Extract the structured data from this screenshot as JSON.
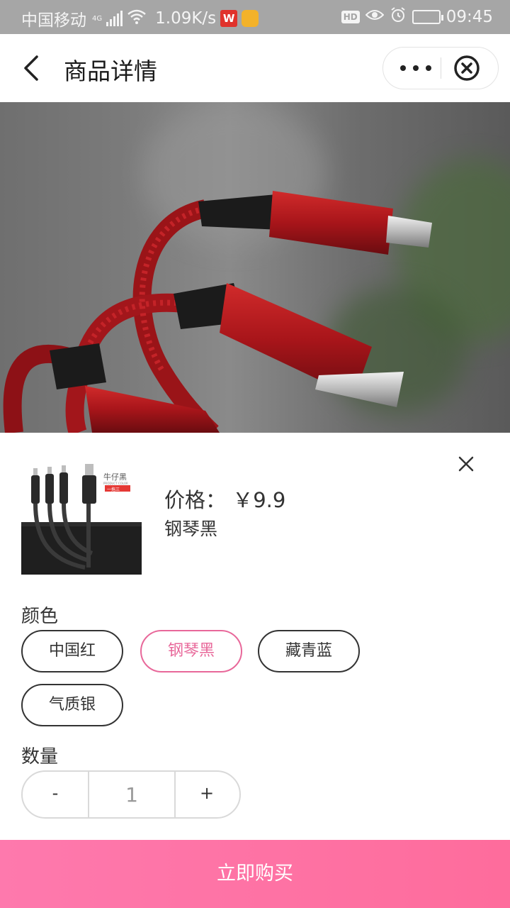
{
  "status_bar": {
    "carrier": "中国移动",
    "network": "4G",
    "speed": "1.09K/s",
    "hd": "HD",
    "time": "09:45",
    "icons": [
      "signal-icon",
      "wifi-icon",
      "wps-app-icon",
      "notification-app-icon",
      "hd-icon",
      "eye-icon",
      "alarm-icon",
      "battery-icon"
    ]
  },
  "nav": {
    "title": "商品详情",
    "back_icon": "chevron-left-icon",
    "more_icon": "more-dots-icon",
    "close_icon": "circle-close-icon"
  },
  "hero_image": {
    "subject": "red-braided-charging-cable-photo"
  },
  "sheet": {
    "close_icon": "close-x-icon",
    "thumbnail": {
      "tag_line1": "牛仔黑",
      "tag_line2": "PRODUCT COLOR",
      "tag_badge": "一拖三"
    },
    "price": "价格： ￥9.9",
    "selected_color": "钢琴黑",
    "color_label": "颜色",
    "colors": [
      {
        "label": "中国红",
        "active": false
      },
      {
        "label": "钢琴黑",
        "active": true
      },
      {
        "label": "藏青蓝",
        "active": false
      },
      {
        "label": "气质银",
        "active": false
      }
    ],
    "quantity_label": "数量",
    "quantity": {
      "minus": "-",
      "value": "1",
      "plus": "+"
    },
    "buy_button": "立即购买"
  },
  "colors": {
    "accent_pink": "#e8689a",
    "buy_gradient_start": "#fe79ad",
    "buy_gradient_end": "#fe6c9c",
    "status_bar_bg": "#a6a6a6"
  }
}
